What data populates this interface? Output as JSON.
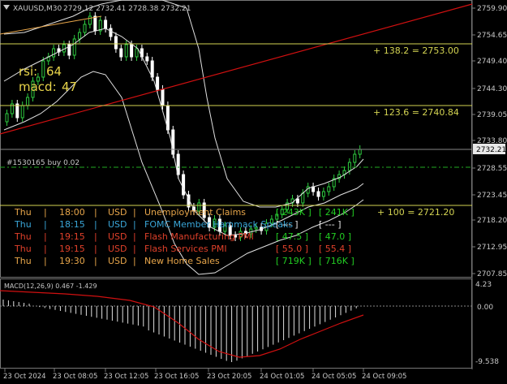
{
  "header": {
    "symbol": "XAUUSD,M30",
    "ohlc": "2729.12 2732.41 2728.38 2732.21"
  },
  "indicators": {
    "rsi_label": "rsi:",
    "rsi_value": "64",
    "macd_label": "macd:",
    "macd_value": "47"
  },
  "order_line_label": "#1530165 buy 0.02",
  "fib_levels": [
    {
      "label": "+ 138.2  = 2753.00",
      "price": 2753.0
    },
    {
      "label": "+ 123.6  = 2740.84",
      "price": 2740.84
    },
    {
      "label": "+ 100  = 2721.20",
      "price": 2721.2
    }
  ],
  "price_axis": {
    "ticks": [
      "2759.90",
      "2754.65",
      "2749.40",
      "2744.30",
      "2739.05",
      "2733.80",
      "2728.55",
      "2723.45",
      "2718.20",
      "2712.95",
      "2707.85"
    ],
    "current_price": "2732.21"
  },
  "macd_panel": {
    "label": "MACD(12,26,9) 0.467 -1.429",
    "axis_ticks": [
      "4.23",
      "0.00",
      "-9.538"
    ]
  },
  "time_axis": [
    "23 Oct 2024",
    "23 Oct 08:05",
    "23 Oct 12:05",
    "23 Oct 16:05",
    "23 Oct 20:05",
    "24 Oct 01:05",
    "24 Oct 05:05",
    "24 Oct 09:05"
  ],
  "news": [
    {
      "day": "Thu",
      "time": "18:00",
      "currency": "USD",
      "event": "Unemployment Claims",
      "actual": "[ 243K ]",
      "forecast": "[ 241K ]",
      "color": "#e8a64a",
      "value_color": "#22cc22"
    },
    {
      "day": "Thu",
      "time": "18:15",
      "currency": "USD",
      "event": "FOMC Member Hammack Speaks",
      "actual": "[ --- ]",
      "forecast": "[ --- ]",
      "color": "#3aa6d8",
      "value_color": "#e8e8e8"
    },
    {
      "day": "Thu",
      "time": "19:15",
      "currency": "USD",
      "event": "Flash Manufacturing PMI",
      "actual": "[ 47.5 ]",
      "forecast": "[ 47.0 ]",
      "color": "#e0402a",
      "value_color": "#22cc22"
    },
    {
      "day": "Thu",
      "time": "19:15",
      "currency": "USD",
      "event": "Flash Services PMI",
      "actual": "[ 55.0 ]",
      "forecast": "[ 55.4 ]",
      "color": "#e0402a",
      "value_color": "#e0402a"
    },
    {
      "day": "Thu",
      "time": "19:30",
      "currency": "USD",
      "event": "New Home Sales",
      "actual": "[ 719K ]",
      "forecast": "[ 716K ]",
      "color": "#e8a64a",
      "value_color": "#22cc22"
    }
  ],
  "colors": {
    "background": "#000000",
    "bull_candle": "#2ecc40",
    "bear_candle": "#ffffff",
    "fib_line": "#d4d452",
    "trend_line": "#d01010",
    "bollinger": "#e0e0e0",
    "macd_signal": "#d01010"
  }
}
